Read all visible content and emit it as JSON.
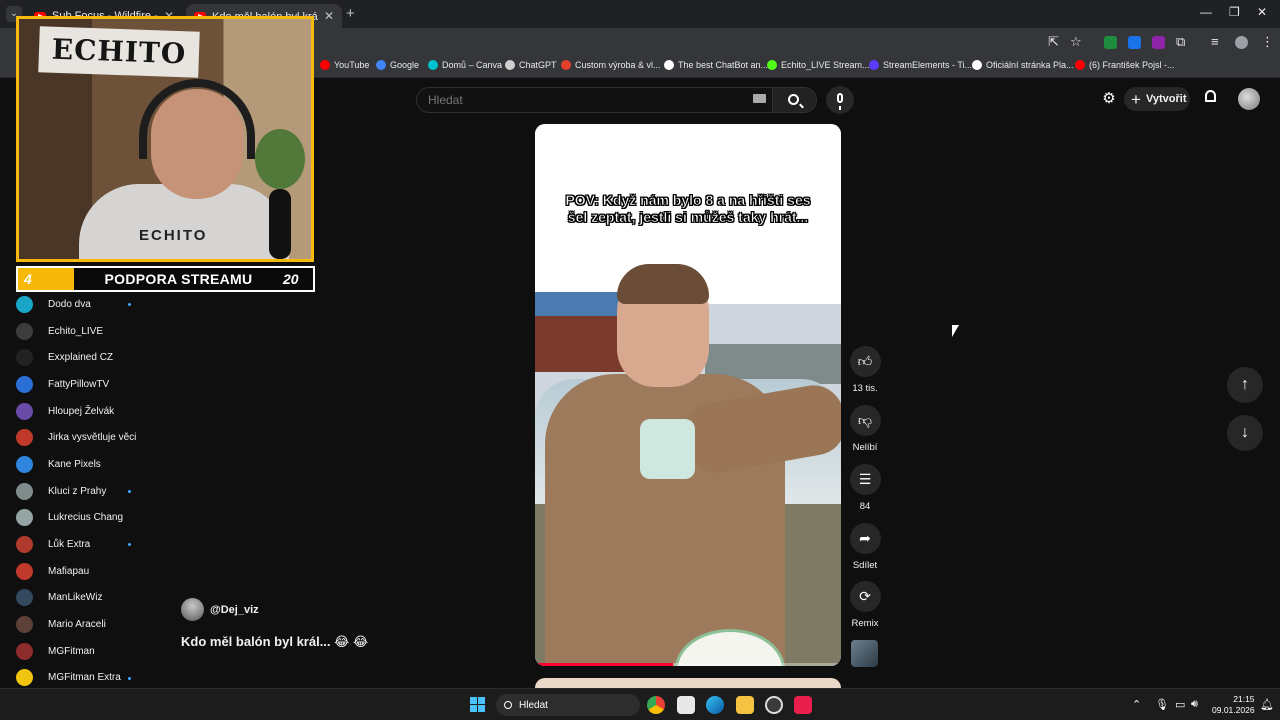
{
  "browser": {
    "tabs": [
      {
        "title": "Sub Focus - Wildfire - YouTube",
        "active": false
      },
      {
        "title": "Kdo měl balón byl král... 😂 😂",
        "active": true
      }
    ],
    "bookmarks": [
      {
        "label": "YouTube",
        "icon": "youtube-icon",
        "color": "#ff0000"
      },
      {
        "label": "Google",
        "icon": "google-icon",
        "color": "#4285f4"
      },
      {
        "label": "Domů – Canva",
        "icon": "canva-icon",
        "color": "#00c4cc"
      },
      {
        "label": "ChatGPT",
        "icon": "chatgpt-icon",
        "color": "#cfcfcf"
      },
      {
        "label": "Custom výroba & vl...",
        "icon": "shop-icon",
        "color": "#e4412b"
      },
      {
        "label": "The best ChatBot an...",
        "icon": "chatbot-icon",
        "color": "#ffffff"
      },
      {
        "label": "Echito_LIVE Stream...",
        "icon": "kick-icon",
        "color": "#53fc18"
      },
      {
        "label": "StreamElements - Ti...",
        "icon": "streamelements-icon",
        "color": "#5c3bfe"
      },
      {
        "label": "Oficiální stránka Pla...",
        "icon": "playstation-icon",
        "color": "#ffffff"
      },
      {
        "label": "(6) František Pojsl -...",
        "icon": "youtube-icon",
        "color": "#ff0000"
      }
    ]
  },
  "youtube": {
    "search_placeholder": "Hledat",
    "create_label": "Vytvořit",
    "subscriptions": [
      {
        "name": "Dodo dva",
        "new": true,
        "color": "#1aa6c8"
      },
      {
        "name": "Echito_LIVE",
        "new": false,
        "color": "#3c3c3c"
      },
      {
        "name": "Exxplained CZ",
        "new": false,
        "color": "#222222"
      },
      {
        "name": "FattyPillowTV",
        "new": false,
        "color": "#2a6fd6"
      },
      {
        "name": "Hloupej Želvák",
        "new": false,
        "color": "#6a4ca8"
      },
      {
        "name": "Jirka vysvětluje věci",
        "new": false,
        "color": "#c0392b"
      },
      {
        "name": "Kane Pixels",
        "new": false,
        "color": "#2e86de"
      },
      {
        "name": "Kluci z Prahy",
        "new": true,
        "color": "#7f8c8d"
      },
      {
        "name": "Lukrecius Chang",
        "new": false,
        "color": "#95a5a6"
      },
      {
        "name": "Lůk Extra",
        "new": true,
        "color": "#b03a2e"
      },
      {
        "name": "Mafiapau",
        "new": false,
        "color": "#c0392b"
      },
      {
        "name": "ManLikeWiz",
        "new": false,
        "color": "#34495e"
      },
      {
        "name": "Mario Araceli",
        "new": false,
        "color": "#5d4037"
      },
      {
        "name": "MGFitman",
        "new": false,
        "color": "#8e2b2b"
      },
      {
        "name": "MGFitman Extra",
        "new": true,
        "color": "#f1c40f"
      }
    ],
    "short": {
      "caption": "POV: Když nám bylo 8 a na hřišti ses šel zeptat, jestli si můžeš taky hrát...",
      "channel": "@Dej_viz",
      "title": "Kdo měl balón byl král... 😂 😂",
      "progress": 0.45
    },
    "actions": {
      "likes": "13 tis.",
      "dislike_label": "Nelíbí",
      "comments": "84",
      "share_label": "Sdílet",
      "remix_label": "Remix"
    }
  },
  "stream_overlay": {
    "sign_text": "ECHITO",
    "shirt_text": "ECHITO",
    "support_label": "PODPORA STREAMU",
    "support_current": "4",
    "support_goal": "20"
  },
  "taskbar": {
    "search_placeholder": "Hledat",
    "time": "21:15",
    "date": "09.01.2026"
  }
}
